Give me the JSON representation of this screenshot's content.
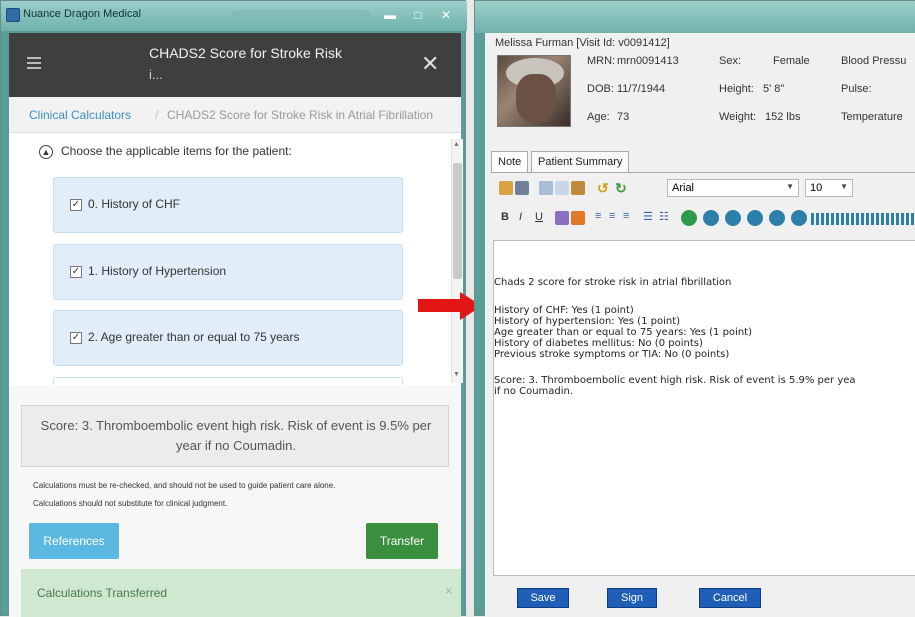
{
  "left_window": {
    "title": "Nuance Dragon Medical",
    "header": {
      "title_line1": "CHADS2 Score for Stroke Risk",
      "title_line2": "i...",
      "close": "✕"
    },
    "breadcrumb": {
      "link": "Clinical Calculators",
      "separator": "/",
      "current": "CHADS2 Score for Stroke Risk in Atrial Fibrillation"
    },
    "choose_label": "Choose the applicable items for the patient:",
    "items": [
      {
        "label": "0. History of CHF",
        "checked": true
      },
      {
        "label": "1. History of Hypertension",
        "checked": true
      },
      {
        "label": "2. Age greater than or equal to 75 years",
        "checked": true
      }
    ],
    "score_text": "Score: 3. Thromboembolic event high risk. Risk of event is 9.5% per year if no Coumadin.",
    "disclaimer_1": "Calculations must be re-checked, and should not be used to guide patient care alone.",
    "disclaimer_2": "Calculations should not substitute for clinical judgment.",
    "references_label": "References",
    "transfer_label": "Transfer",
    "transferred_label": "Calculations Transferred",
    "transferred_close": "×"
  },
  "right_window": {
    "patient_header": "Melissa Furman [Visit Id: v0091412]",
    "fields": {
      "mrn_label": "MRN:",
      "mrn": "mrn0091413",
      "dob_label": "DOB:",
      "dob": "11/7/1944",
      "age_label": "Age:",
      "age": "73",
      "sex_label": "Sex:",
      "sex": "Female",
      "height_label": "Height:",
      "height": "5' 8\"",
      "weight_label": "Weight:",
      "weight": "152 lbs",
      "bp_label": "Blood Pressu",
      "pulse_label": "Pulse:",
      "temp_label": "Temperature"
    },
    "tabs": [
      "Note",
      "Patient Summary"
    ],
    "font": "Arial",
    "font_size": "10",
    "format_buttons": [
      "B",
      "I",
      "U"
    ],
    "note_lines": [
      "Chads 2 score for stroke risk in atrial fibrillation",
      "",
      "History of CHF: Yes (1 point)",
      "History of hypertension: Yes (1 point)",
      "Age greater than or equal to 75 years: Yes (1 point)",
      "History of diabetes mellitus: No (0 points)",
      "Previous stroke symptoms or TIA: No (0 points)",
      "",
      "Score: 3.  Thromboembolic event high risk.  Risk of event is 5.9% per yea",
      "if no Coumadin."
    ],
    "buttons": {
      "save": "Save",
      "sign": "Sign",
      "cancel": "Cancel"
    }
  },
  "colors": {
    "window_frame": "#5a9e9a",
    "calc_header": "#3f3f3f",
    "item_bg": "#e1eef9",
    "references_btn": "#5bb8e0",
    "transfer_btn": "#3a8f3e",
    "arrow": "#e31616",
    "note_btn": "#1f5fb8"
  }
}
